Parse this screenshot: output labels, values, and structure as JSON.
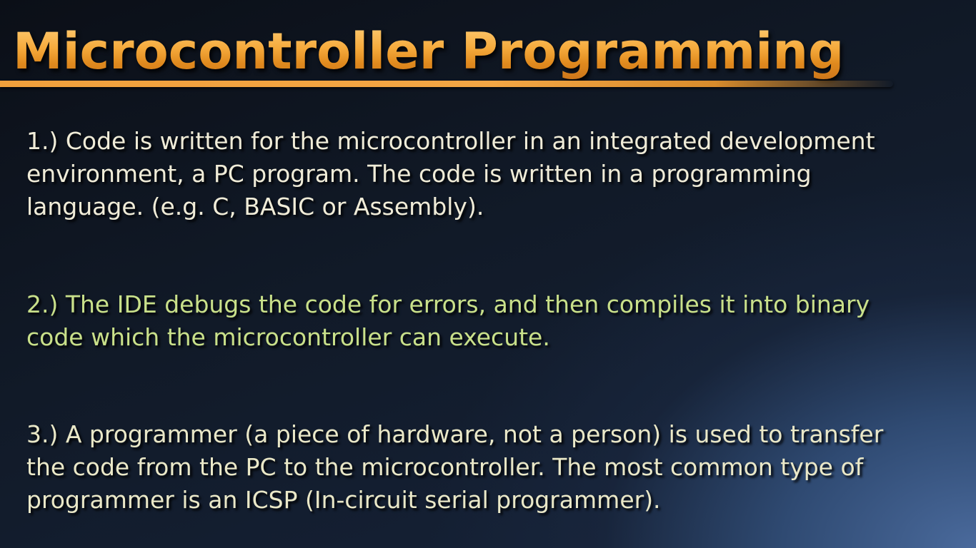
{
  "slide": {
    "title": "Microcontroller Programming",
    "points": [
      {
        "lines": [
          "1.) Code is written for the microcontroller in an integrated development",
          "environment, a PC program. The code is written in a programming",
          "language. (e.g. C, BASIC or Assembly)."
        ]
      },
      {
        "lines": [
          "2.) The IDE debugs the code for errors, and then compiles it into binary",
          "code which the microcontroller can execute."
        ]
      },
      {
        "lines": [
          "3.) A programmer (a piece of hardware, not a person) is used to transfer",
          "the code from the PC to the microcontroller. The most common type of",
          "programmer is an ICSP (In-circuit serial programmer)."
        ]
      }
    ]
  },
  "colors": {
    "title_orange": "#f5aa3c",
    "point_1_text": "#f0ecd8",
    "point_2_text": "#c9e08a",
    "point_3_text": "#eae8c8",
    "background_dark": "#0b0f17",
    "background_blue": "#4a6a9c"
  }
}
